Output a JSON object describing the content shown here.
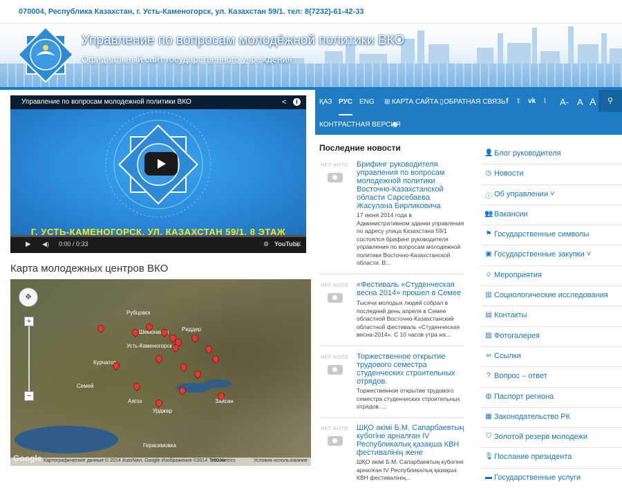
{
  "header": {
    "address": "070004, Республика Казахстан, г. Усть-Каменогорск, ул. Казахстан 59/1. тел: 8(7232)-61-42-33",
    "title": "Управление по вопросам молодёжной политики ВКО",
    "subtitle": "Официальный сайт государственного учреждения"
  },
  "video": {
    "title": "Управление по вопросам молодежной политики ВКО",
    "caption": "Г. УСТЬ-КАМЕНОГОРСК, УЛ. КАЗАХСТАН 59/1,  8 ЭТАЖ",
    "time": "0:00 / 0:33",
    "youtube": "YouTube"
  },
  "map": {
    "title": "Карта молодежных центров ВКО",
    "attribution": "Картографические данные © 2014 AutoNavi, Google Изображения ©2014 TerraMetrics",
    "scale": "100 км",
    "terms": "Условия использования",
    "google": "Google",
    "places": [
      "Рубцовск",
      "Усть-Каменогорск",
      "Риддер",
      "Шемонаиха",
      "Семей",
      "Аягоз",
      "Урджар",
      "Зайсан",
      "Курчатов",
      "Герасимовка"
    ]
  },
  "nav": {
    "lang_kz": "ҚАЗ",
    "lang_ru": "РУС",
    "lang_en": "ENG",
    "sitemap": "КАРТА САЙТА",
    "feedback": "ОБРАТНАЯ СВЯЗЬ",
    "font_small": "A-",
    "font_mid": "A",
    "font_big": "A",
    "contrast": "КОНТРАСТНАЯ ВЕРСИЯ"
  },
  "news": {
    "heading": "Последние новости",
    "no_photo": "НЕТ ФОТО",
    "items": [
      {
        "title": "Брифинг руководителя управления по вопросам молодежной политики Восточно-Казахстанской области Сарсебаева Жасулана Бирликовича",
        "text": "17 июня 2014 года в Административном здании управления по адресу улица Казахстана 59/1 состоялся брифинг руководителя управления по вопросам молодежной политики Восточно-Казахстанской области. В..."
      },
      {
        "title": "«Фестиваль «Студенческая весна 2014» прошел в Семее",
        "text": "Тысячи молодых людей собрал в последний день апреля в Семее областной Восточно-Казахстанский областной фестиваль «Студенческая весна-2014». С 10 часов утра на..."
      },
      {
        "title": "Торжественное открытие трудового семестра студенческих строительных отрядов.",
        "text": "Торжественное открытие трудового семестра студенческих строительных отрядов. ..."
      },
      {
        "title": "ШҚО әкімі Б.М. Сапарбаевтың кубогіне арналған IV Республикалық қазақша КВН фестивалінің жене",
        "text": "ШҚО әкімі Б.М. Сапарбаевтың кубогіне арналған IV Республикалық қазақша КВН фестивалінің..."
      }
    ]
  },
  "menu": [
    {
      "icon": "user-icon",
      "glyph": "👤",
      "label": "Блог руководителя"
    },
    {
      "icon": "clock-icon",
      "glyph": "◷",
      "label": "Новости"
    },
    {
      "icon": "info-icon",
      "glyph": "ⓘ",
      "label": "Об управлении ˅"
    },
    {
      "icon": "group-icon",
      "glyph": "👥",
      "label": "Вакансии"
    },
    {
      "icon": "flag-icon",
      "glyph": "⚑",
      "label": "Государственные символы"
    },
    {
      "icon": "money-icon",
      "glyph": "▣",
      "label": "Государственные закупки ˅"
    },
    {
      "icon": "smile-icon",
      "glyph": "☺",
      "label": "Мероприятия"
    },
    {
      "icon": "chart-icon",
      "glyph": "▥",
      "label": "Социологические исследования"
    },
    {
      "icon": "contact-icon",
      "glyph": "▤",
      "label": "Контакты"
    },
    {
      "icon": "picture-icon",
      "glyph": "▨",
      "label": "Фотогалерея"
    },
    {
      "icon": "link-icon",
      "glyph": "∞",
      "label": "Ссылки"
    },
    {
      "icon": "question-icon",
      "glyph": "?",
      "label": "Вопрос – ответ"
    },
    {
      "icon": "globe-icon",
      "glyph": "◍",
      "label": "Паспорт региона"
    },
    {
      "icon": "book-icon",
      "glyph": "▦",
      "label": "Законодательство РК"
    },
    {
      "icon": "shield-icon",
      "glyph": "⛉",
      "label": "Золотой резерв молодежи"
    },
    {
      "icon": "microphone-icon",
      "glyph": "🎙",
      "label": "Послание президента"
    },
    {
      "icon": "briefcase-icon",
      "glyph": "▬",
      "label": "Государственные услуги"
    }
  ],
  "colors": {
    "accent": "#1e7cc4",
    "link": "#1a73c0",
    "caption": "#ffe600"
  }
}
